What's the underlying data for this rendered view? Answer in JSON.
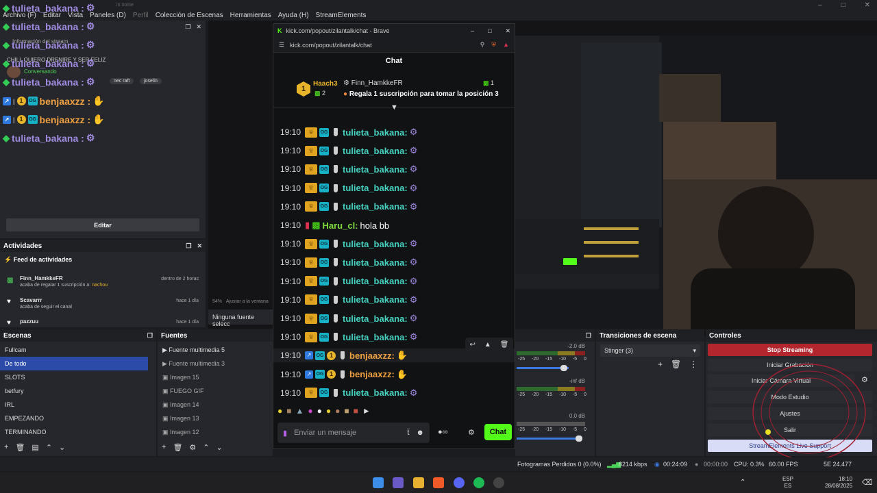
{
  "menu": [
    "Archivo (F)",
    "Editar",
    "Vista",
    "Paneles (D)",
    "Perfil",
    "Colección de Escenas",
    "Herramientas",
    "Ayuda (H)",
    "StreamElements"
  ],
  "window_title_partial": "in nome",
  "overlay_chat": [
    {
      "name": "tulieta_bakana :",
      "style": "green"
    },
    {
      "name": "tulieta_bakana :",
      "style": "green"
    },
    {
      "name": "tulieta_bakana :",
      "style": "green"
    },
    {
      "name": "tulieta_bakana :",
      "style": "green"
    },
    {
      "name": "tulieta_bakana :",
      "style": "green"
    },
    {
      "name": "benjaaxzz :",
      "style": "orange"
    },
    {
      "name": "benjaaxzz :",
      "style": "orange"
    },
    {
      "name": "tulieta_bakana :",
      "style": "green"
    }
  ],
  "info_panel": {
    "info_label": "Información del stream",
    "title_text": "CHILL QUIERO DRENIRE Y SER FELIZ",
    "status": "Conversando",
    "tags": [
      "nec raft",
      "joselin"
    ],
    "edit_button": "Editar"
  },
  "activities": {
    "title": "Actividades",
    "feed_title": "Feed de actividades",
    "items": [
      {
        "user": "Finn_HamkkeFR",
        "desc": "acaba de regalar 1 suscripción a:",
        "target": "nachou",
        "time": "dentro de 2 horas"
      },
      {
        "user": "Scavarrr",
        "desc": "acaba de seguir el canal",
        "target": "",
        "time": "hace 1 día"
      },
      {
        "user": "pazzuu",
        "desc": "",
        "target": "",
        "time": "hace 1 día"
      }
    ]
  },
  "preview": {
    "zoom": "54%",
    "fit_label": "Ajustar a la ventana",
    "no_source": "Ninguna fuente selecc"
  },
  "browser": {
    "tab_title": "kick.com/popout/zilantalk/chat - Brave",
    "url": "kick.com/popout/zilantalk/chat",
    "chat_header": "Chat",
    "pinned": {
      "rank": "1",
      "rank_user": "Haach3",
      "rank_count": "2",
      "gifter": "Finn_HamkkeFR",
      "gift_count": "1",
      "gift_text": "Regala 1 suscripción para tomar la posición 3"
    },
    "messages": [
      {
        "time": "19:10",
        "user": "tulieta_bakana:",
        "kind": "b"
      },
      {
        "time": "19:10",
        "user": "tulieta_bakana:",
        "kind": "b"
      },
      {
        "time": "19:10",
        "user": "tulieta_bakana:",
        "kind": "b"
      },
      {
        "time": "19:10",
        "user": "tulieta_bakana:",
        "kind": "b"
      },
      {
        "time": "19:10",
        "user": "tulieta_bakana:",
        "kind": "b"
      },
      {
        "time": "19:10",
        "user": "Haru_cl:",
        "kind": "h",
        "text": "hola bb"
      },
      {
        "time": "19:10",
        "user": "tulieta_bakana:",
        "kind": "b"
      },
      {
        "time": "19:10",
        "user": "tulieta_bakana:",
        "kind": "b"
      },
      {
        "time": "19:10",
        "user": "tulieta_bakana:",
        "kind": "b"
      },
      {
        "time": "19:10",
        "user": "tulieta_bakana:",
        "kind": "b"
      },
      {
        "time": "19:10",
        "user": "tulieta_bakana:",
        "kind": "b"
      },
      {
        "time": "19:10",
        "user": "tulieta_bakana:",
        "kind": "b"
      },
      {
        "time": "19:10",
        "user": "benjaaxzz:",
        "kind": "z"
      },
      {
        "time": "19:10",
        "user": "benjaaxzz:",
        "kind": "z"
      },
      {
        "time": "19:10",
        "user": "tulieta_bakana:",
        "kind": "b"
      }
    ],
    "input_placeholder": "Enviar un mensaje",
    "send_button": "Chat"
  },
  "scenes": {
    "title": "Escenas",
    "items": [
      "Fullcam",
      "De todo",
      "SLOTS",
      "betfury",
      "IRL",
      "EMPEZANDO",
      "TERMINANDO"
    ],
    "selected": 1
  },
  "sources": {
    "title": "Fuentes",
    "items": [
      "Fuente multimedia 5",
      "Fuente multimedia 3",
      "Imagen 15",
      "FUEGO GIF",
      "Imagen 14",
      "Imagen 13",
      "Imagen 12"
    ]
  },
  "mixer": {
    "db": [
      "-2.0 dB",
      "-inf dB",
      "0.0 dB"
    ],
    "ticks": [
      "-25",
      "-20",
      "-15",
      "-10",
      "-5",
      "0"
    ]
  },
  "transitions": {
    "title": "Transiciones de escena",
    "value": "Stinger (3)"
  },
  "controls": {
    "title": "Controles",
    "buttons": [
      "Stop Streaming",
      "Iniciar Grabación",
      "Iniciar Cámara Virtual",
      "Modo Estudio",
      "Ajustes",
      "Salir",
      "StreamElements Live Support"
    ]
  },
  "status": {
    "dropped": "Fotogramas Perdidos 0 (0.0%)",
    "bitrate": "8214 kbps",
    "live_time": "00:24:09",
    "rec_time": "00:00:00",
    "cpu": "CPU: 0.3%",
    "fps": "60.00 FPS",
    "misc": "5E 24.477"
  },
  "taskbar": {
    "lang": "ESP",
    "lang2": "ES",
    "time": "18:10",
    "date": "28/08/2025"
  },
  "colors": {
    "accent_green": "#53fc18",
    "stop_red": "#b3262e",
    "selected_blue": "#2c4aa8"
  }
}
